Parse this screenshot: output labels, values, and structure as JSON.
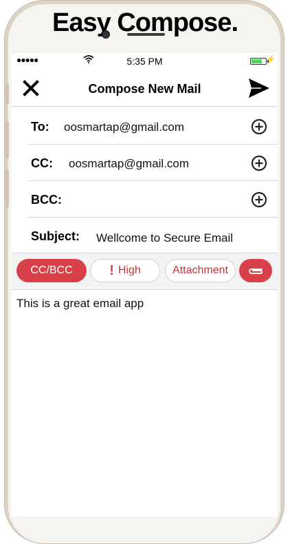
{
  "headline": "Easy Compose.",
  "status_bar": {
    "signal": "●●●●●",
    "time": "5:35 PM",
    "battery_level": 0.75
  },
  "nav": {
    "title": "Compose New Mail",
    "close_icon": "close-x-icon",
    "send_icon": "send-paper-plane-icon"
  },
  "fields": {
    "to": {
      "label": "To:",
      "value": "oosmartap@gmail.com"
    },
    "cc": {
      "label": "CC:",
      "value": "oosmartap@gmail.com"
    },
    "bcc": {
      "label": "BCC:",
      "value": ""
    },
    "subject": {
      "label": "Subject:",
      "value": "Wellcome to Secure Email"
    }
  },
  "toolbar": {
    "cc_bcc": "CC/BCC",
    "priority_mark": "!",
    "priority": "High",
    "attachment": "Attachment",
    "paperclip_icon": "paperclip-icon"
  },
  "body": {
    "text": "This is a great email app"
  },
  "colors": {
    "accent_red": "#d9414a",
    "battery_green": "#4cd964"
  }
}
